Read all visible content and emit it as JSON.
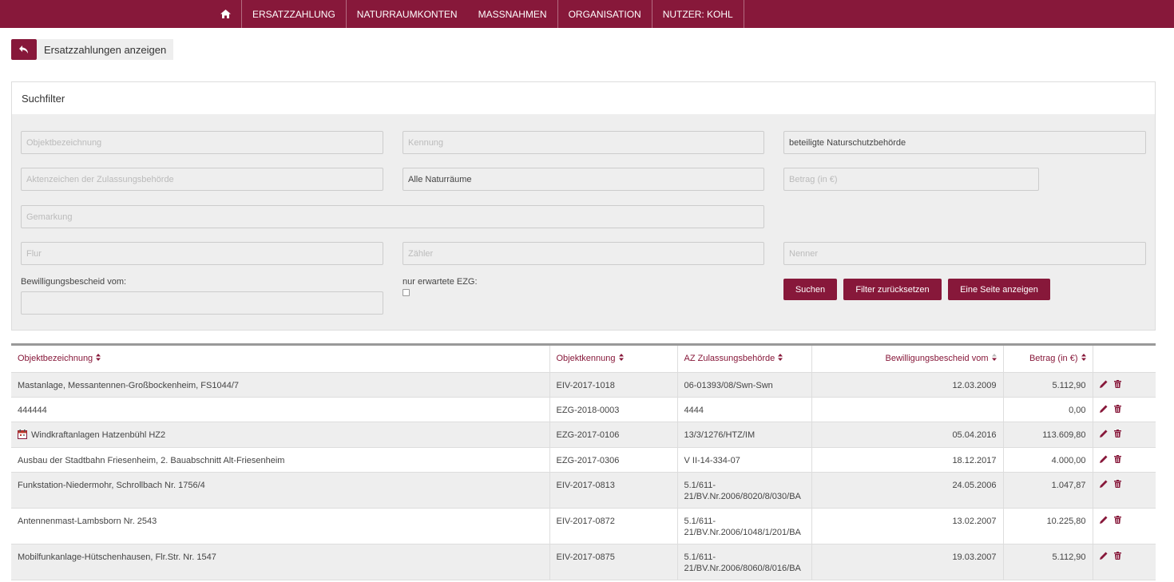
{
  "nav": {
    "items": [
      "Ersatzzahlung",
      "Naturraumkonten",
      "Massnahmen",
      "Organisation",
      "Nutzer: Kohl"
    ]
  },
  "back": {
    "label": "Ersatzzahlungen anzeigen"
  },
  "filter": {
    "title": "Suchfilter",
    "objekt_placeholder": "Objektbezeichnung",
    "kennung_placeholder": "Kennung",
    "naturschutz_value": "beteiligte Naturschutzbehörde",
    "aktenzeichen_placeholder": "Aktenzeichen der Zulassungsbehörde",
    "naturraum_value": "Alle Naturräume",
    "betrag_placeholder": "Betrag (in €)",
    "gemarkung_placeholder": "Gemarkung",
    "flur_placeholder": "Flur",
    "zaehler_placeholder": "Zähler",
    "nenner_placeholder": "Nenner",
    "bescheid_label": "Bewilligungsbescheid vom:",
    "erwartet_label": "nur erwartete EZG:",
    "btn_suchen": "Suchen",
    "btn_reset": "Filter zurücksetzen",
    "btn_onepage": "Eine Seite anzeigen"
  },
  "table": {
    "headers": [
      "Objektbezeichnung",
      "Objektkennung",
      "AZ Zulassungsbehörde",
      "Bewilligungsbescheid vom",
      "Betrag (in €)"
    ],
    "rows": [
      [
        "Mastanlage, Messantennen-Großbockenheim, FS1044/7",
        "EIV-2017-1018",
        "06-01393/08/Swn-Swn",
        "12.03.2009",
        "5.112,90"
      ],
      [
        "444444",
        "EZG-2018-0003",
        "4444",
        "",
        "0,00"
      ],
      [
        "Windkraftanlagen Hatzenbühl HZ2",
        "EZG-2017-0106",
        "13/3/1276/HTZ/IM",
        "05.04.2016",
        "113.609,80"
      ],
      [
        "Ausbau der Stadtbahn Friesenheim, 2. Bauabschnitt Alt-Friesenheim",
        "EZG-2017-0306",
        "V II-14-334-07",
        "18.12.2017",
        "4.000,00"
      ],
      [
        "Funkstation-Niedermohr, Schrollbach Nr. 1756/4",
        "EIV-2017-0813",
        "5.1/611-\n21/BV.Nr.2006/8020/8/030/BA",
        "24.05.2006",
        "1.047,87"
      ],
      [
        "Antennenmast-Lambsborn Nr. 2543",
        "EIV-2017-0872",
        "5.1/611-\n21/BV.Nr.2006/1048/1/201/BA",
        "13.02.2007",
        "10.225,80"
      ],
      [
        "Mobilfunkanlage-Hütschenhausen, Flr.Str. Nr. 1547",
        "EIV-2017-0875",
        "5.1/611-\n21/BV.Nr.2006/8060/8/016/BA",
        "19.03.2007",
        "5.112,90"
      ]
    ]
  },
  "colors": {
    "brand": "#87183a"
  }
}
